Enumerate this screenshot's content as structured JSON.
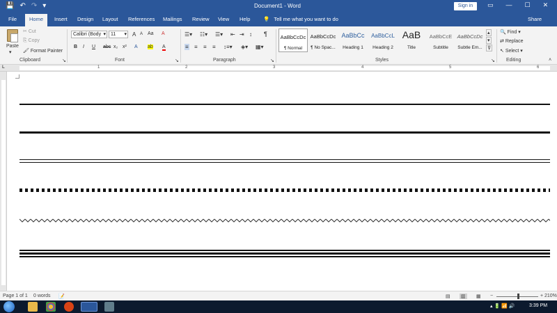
{
  "titlebar": {
    "doc_title": "Document1  -  Word",
    "sign_in": "Sign in",
    "qat": {
      "save": "💾",
      "undo": "↶",
      "redo": "↷",
      "customize": "▾"
    },
    "window": {
      "restore": "▭",
      "minimize": "—",
      "maximize": "☐",
      "close": "✕"
    }
  },
  "tabs": [
    "File",
    "Home",
    "Insert",
    "Design",
    "Layout",
    "References",
    "Mailings",
    "Review",
    "View",
    "Help"
  ],
  "tell_me": "Tell me what you want to do",
  "share": "Share",
  "clipboard": {
    "paste": "Paste",
    "cut": "Cut",
    "copy": "Copy",
    "format_painter": "Format Painter",
    "label": "Clipboard"
  },
  "font": {
    "name": "Calibri (Body",
    "size": "11",
    "label": "Font",
    "bold": "B",
    "italic": "I",
    "underline": "U",
    "strike": "abc",
    "sub": "x₂",
    "sup": "x²",
    "grow": "A",
    "shrink": "A",
    "case": "Aa",
    "clear": "A",
    "effects": "A",
    "highlight": "ab",
    "color": "A"
  },
  "paragraph": {
    "label": "Paragraph",
    "pilcrow": "¶"
  },
  "styles": {
    "label": "Styles",
    "items": [
      {
        "sample": "AaBbCcDc",
        "name": "¶ Normal"
      },
      {
        "sample": "AaBbCcDc",
        "name": "¶ No Spac..."
      },
      {
        "sample": "AaBbCc",
        "name": "Heading 1"
      },
      {
        "sample": "AaBbCcL",
        "name": "Heading 2"
      },
      {
        "sample": "AaB",
        "name": "Title"
      },
      {
        "sample": "AaBbCcE",
        "name": "Subtitle"
      },
      {
        "sample": "AaBbCcDc",
        "name": "Subtle Em..."
      }
    ]
  },
  "editing": {
    "find": "Find",
    "replace": "Replace",
    "select": "Select",
    "label": "Editing"
  },
  "ruler": {
    "numbers": [
      "1",
      "2",
      "3",
      "4",
      "5",
      "6"
    ],
    "marker": "L"
  },
  "status": {
    "page": "Page 1 of 1",
    "words": "0 words",
    "zoom": "210%"
  },
  "taskbar": {
    "time": "3:39 PM"
  },
  "colors": {
    "accent": "#2b579a",
    "taskbar": "#0c1a2e"
  }
}
